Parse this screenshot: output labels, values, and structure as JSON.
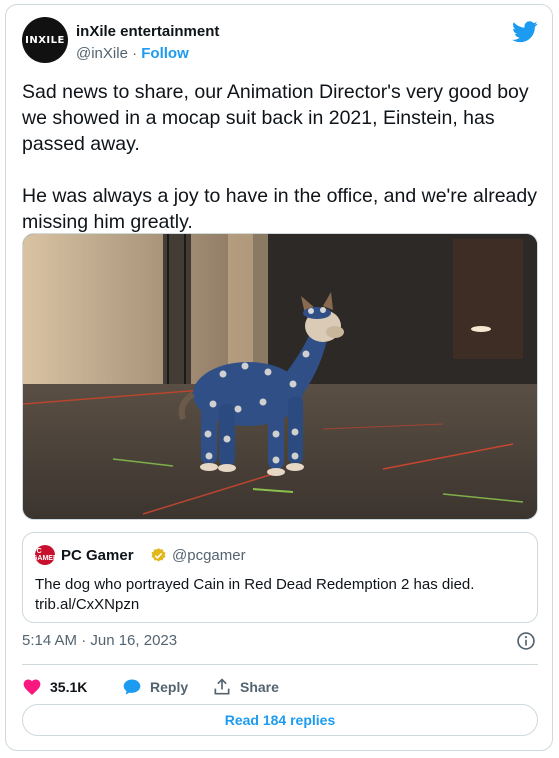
{
  "author": {
    "name": "inXile entertainment",
    "handle": "@inXile",
    "separator": "·",
    "follow_label": "Follow",
    "avatar_text": "INXILE"
  },
  "tweet": {
    "text": "Sad news to share, our Animation Director's very good boy we showed in a mocap suit back in 2021, Einstein, has passed away.\n\nHe was always a joy to have in the office, and we're already missing him greatly."
  },
  "quote": {
    "name": "PC Gamer",
    "handle": "@pcgamer",
    "avatar_text": "PC GAMER",
    "text": "The dog who portrayed Cain in Red Dead Redemption 2 has died.\ntrib.al/CxXNpzn"
  },
  "timestamp": "5:14 AM · Jun 16, 2023",
  "actions": {
    "likes": "35.1K",
    "reply_label": "Reply",
    "share_label": "Share"
  },
  "read_replies_label": "Read 184 replies",
  "colors": {
    "accent": "#1d9bf0",
    "like": "#f91880",
    "muted": "#536471",
    "border": "#cfd9de"
  },
  "icons": [
    "twitter-bird-icon",
    "verified-badge-icon",
    "info-icon",
    "heart-icon",
    "reply-bubble-icon",
    "share-icon"
  ]
}
